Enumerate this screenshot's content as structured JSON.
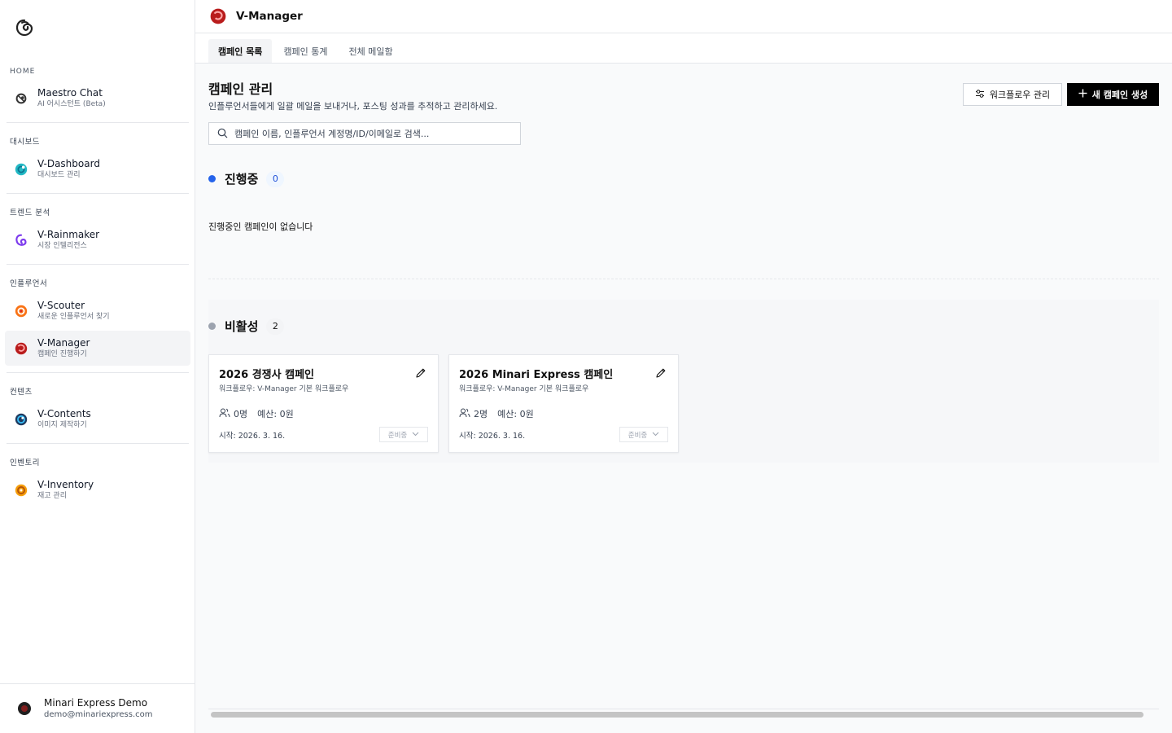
{
  "sidebar": {
    "sections": [
      {
        "label": "HOME",
        "items": [
          {
            "title": "Maestro Chat",
            "sub": "AI 어시스턴트 (Beta)",
            "icon": "maestro-icon"
          }
        ]
      },
      {
        "label": "대시보드",
        "items": [
          {
            "title": "V-Dashboard",
            "sub": "대시보드 관리",
            "icon": "v-dashboard-icon"
          }
        ]
      },
      {
        "label": "트렌드 분석",
        "items": [
          {
            "title": "V-Rainmaker",
            "sub": "시장 인텔리전스",
            "icon": "v-rainmaker-icon"
          }
        ]
      },
      {
        "label": "인플루언서",
        "items": [
          {
            "title": "V-Scouter",
            "sub": "새로운 인플루언서 찾기",
            "icon": "v-scouter-icon"
          },
          {
            "title": "V-Manager",
            "sub": "캠페인 진행하기",
            "icon": "v-manager-icon",
            "active": true
          }
        ]
      },
      {
        "label": "컨텐츠",
        "items": [
          {
            "title": "V-Contents",
            "sub": "이미지 제작하기",
            "icon": "v-contents-icon"
          }
        ]
      },
      {
        "label": "인벤토리",
        "items": [
          {
            "title": "V-Inventory",
            "sub": "재고 관리",
            "icon": "v-inventory-icon"
          }
        ]
      }
    ],
    "user": {
      "name": "Minari Express Demo",
      "email": "demo@minariexpress.com"
    }
  },
  "header": {
    "title": "V-Manager"
  },
  "tabs": [
    {
      "label": "캠페인 목록",
      "active": true
    },
    {
      "label": "캠페인 통계"
    },
    {
      "label": "전체 메일함"
    }
  ],
  "main": {
    "title": "캠페인 관리",
    "description": "인플루언서들에게 일괄 메일을 보내거나, 포스팅 성과를 추적하고 관리하세요.",
    "workflow_button": "워크플로우 관리",
    "new_button": "새 캠페인 생성",
    "search_placeholder": "캠페인 이름, 인플루언서 계정명/ID/이메일로 검색...",
    "active_section": {
      "title": "진행중",
      "count": "0",
      "empty": "진행중인 캠페인이 없습니다",
      "dot_color": "#2563eb"
    },
    "inactive_section": {
      "title": "비활성",
      "count": "2",
      "dot_color": "#9ca3af"
    },
    "cards": [
      {
        "title": "2026 경쟁사 캠페인",
        "workflow": "워크플로우: V-Manager 기본 워크플로우",
        "people": "0명",
        "budget": "예산: 0원",
        "start": "시작: 2026. 3. 16.",
        "status": "준비중"
      },
      {
        "title": "2026 Minari Express 캠페인",
        "workflow": "워크플로우: V-Manager 기본 워크플로우",
        "people": "2명",
        "budget": "예산: 0원",
        "start": "시작: 2026. 3. 16.",
        "status": "준비중"
      }
    ]
  },
  "colors": {
    "accent": "#000000",
    "active_blue": "#2563eb",
    "brand_red": "#c81e1e"
  }
}
